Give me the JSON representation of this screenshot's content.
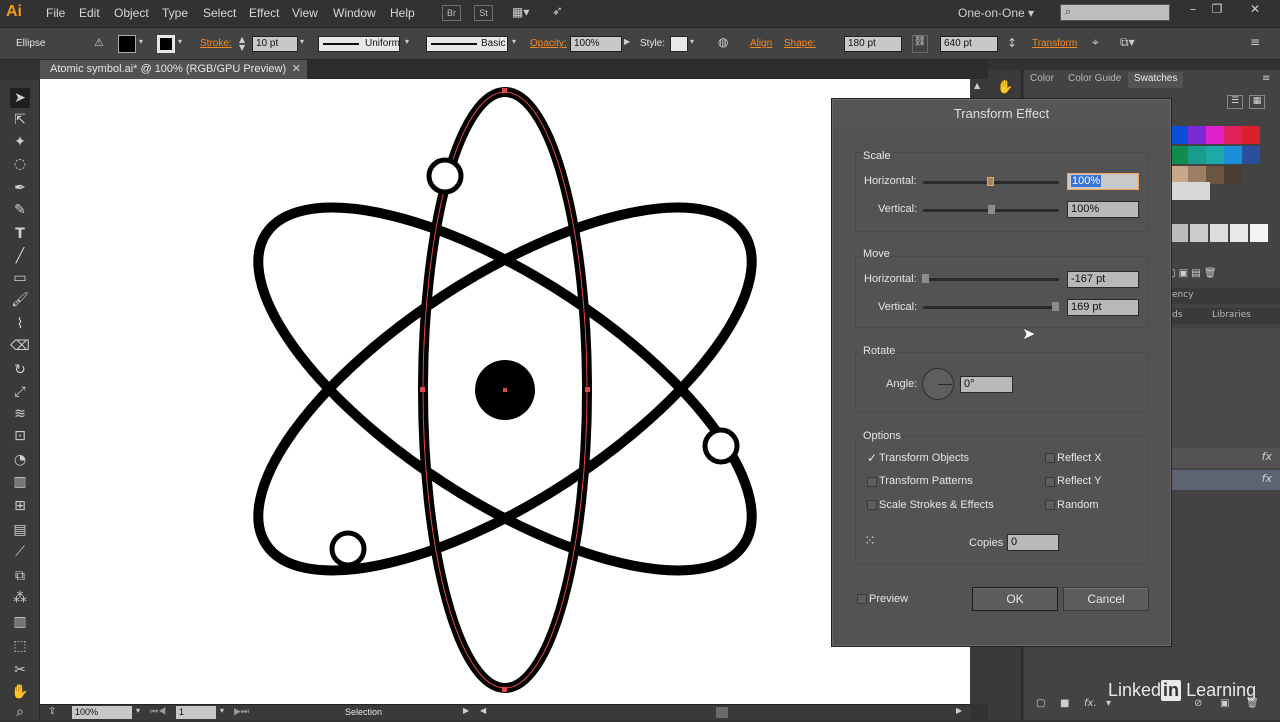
{
  "app": {
    "logo": "Ai"
  },
  "menu": [
    "File",
    "Edit",
    "Object",
    "Type",
    "Select",
    "Effect",
    "View",
    "Window",
    "Help"
  ],
  "app_buttons": {
    "bridge": "Br",
    "stock": "St"
  },
  "workspace": {
    "label": "One-on-One"
  },
  "control": {
    "object_type": "Ellipse",
    "stroke_label": "Stroke:",
    "stroke_value": "10 pt",
    "profile": "Uniform",
    "brush": "Basic",
    "opacity_label": "Opacity:",
    "opacity_value": "100%",
    "style_label": "Style:",
    "align_label": "Align",
    "shape_label": "Shape:",
    "width_value": "180 pt",
    "height_value": "640 pt",
    "transform_label": "Transform"
  },
  "document": {
    "tab_title": "Atomic symbol.ai* @ 100% (RGB/GPU Preview)"
  },
  "status": {
    "zoom": "100%",
    "artboard": "1",
    "tool": "Selection"
  },
  "panels": {
    "tabs": [
      "Color",
      "Color Guide",
      "Swatches"
    ],
    "active": "Swatches",
    "sub_tabs": [
      "ds",
      "Libraries"
    ],
    "partial_tab": "ency",
    "fx_label": "fx"
  },
  "dialog": {
    "title": "Transform Effect",
    "scale": {
      "label": "Scale",
      "horizontal_label": "Horizontal:",
      "horizontal_value": "100%",
      "vertical_label": "Vertical:",
      "vertical_value": "100%"
    },
    "move": {
      "label": "Move",
      "horizontal_label": "Horizontal:",
      "horizontal_value": "-167 pt",
      "vertical_label": "Vertical:",
      "vertical_value": "169 pt"
    },
    "rotate": {
      "label": "Rotate",
      "angle_label": "Angle:",
      "angle_value": "0°"
    },
    "options": {
      "label": "Options",
      "transform_objects": {
        "label": "Transform Objects",
        "checked": true
      },
      "transform_patterns": {
        "label": "Transform Patterns",
        "checked": false
      },
      "scale_strokes": {
        "label": "Scale Strokes & Effects",
        "checked": false
      },
      "reflect_x": {
        "label": "Reflect X",
        "checked": false
      },
      "reflect_y": {
        "label": "Reflect Y",
        "checked": false
      },
      "random": {
        "label": "Random",
        "checked": false
      },
      "copies_label": "Copies",
      "copies_value": "0"
    },
    "preview_label": "Preview",
    "ok_label": "OK",
    "cancel_label": "Cancel"
  },
  "watermark": {
    "brand": "Linked",
    "in": "in",
    "suffix": "Learning"
  },
  "colors": {
    "accent_orange": "#f08a24",
    "selection_red": "#e0464e",
    "canvas": "#ffffff",
    "ui_dark": "#323232"
  }
}
